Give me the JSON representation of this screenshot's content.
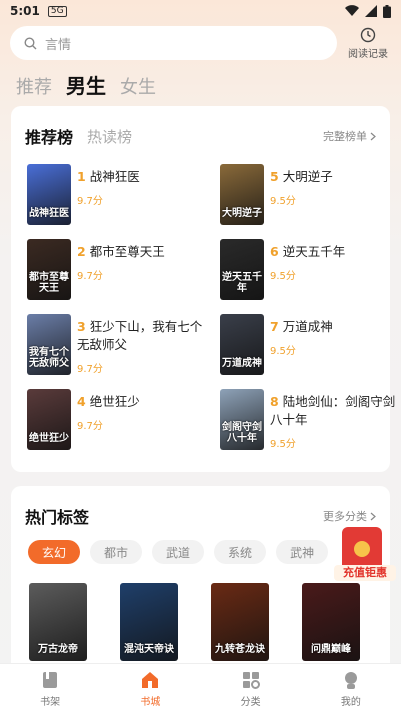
{
  "status": {
    "time": "5:01",
    "sim_label": "5G"
  },
  "search": {
    "placeholder": "言情"
  },
  "history": {
    "label": "阅读记录"
  },
  "top_tabs": [
    {
      "label": "推荐",
      "active": false
    },
    {
      "label": "男生",
      "active": true
    },
    {
      "label": "女生",
      "active": false
    }
  ],
  "ranking": {
    "title": "推荐榜",
    "sub_tab": "热读榜",
    "more": "完整榜单",
    "items": [
      {
        "num": "1",
        "name": "战神狂医",
        "score": "9.7分",
        "cover_text": "战神狂医",
        "cover_color": "#4a6fd8"
      },
      {
        "num": "2",
        "name": "都市至尊天王",
        "score": "9.7分",
        "cover_text": "都市至尊天王",
        "cover_color": "#3b2a22"
      },
      {
        "num": "3",
        "name": "狂少下山，我有七个无敌师父",
        "score": "9.7分",
        "cover_text": "我有七个无敌师父",
        "cover_color": "#6b7ea8"
      },
      {
        "num": "4",
        "name": "绝世狂少",
        "score": "9.7分",
        "cover_text": "绝世狂少",
        "cover_color": "#5a3b3b"
      },
      {
        "num": "5",
        "name": "大明逆子",
        "score": "9.5分",
        "cover_text": "大明逆子",
        "cover_color": "#8a6a3a"
      },
      {
        "num": "6",
        "name": "逆天五千年",
        "score": "9.5分",
        "cover_text": "逆天五千年",
        "cover_color": "#2a2a2a"
      },
      {
        "num": "7",
        "name": "万道成神",
        "score": "9.5分",
        "cover_text": "万道成神",
        "cover_color": "#3a3f4a"
      },
      {
        "num": "8",
        "name": "陆地剑仙：剑阁守剑八十年",
        "score": "9.5分",
        "cover_text": "剑阁守剑八十年",
        "cover_color": "#8ea2b8"
      }
    ]
  },
  "tags": {
    "title": "热门标签",
    "more": "更多分类",
    "chips": [
      {
        "label": "玄幻",
        "active": true
      },
      {
        "label": "都市",
        "active": false
      },
      {
        "label": "武道",
        "active": false
      },
      {
        "label": "系统",
        "active": false
      },
      {
        "label": "武神",
        "active": false
      }
    ],
    "books": [
      {
        "cover_text": "万古龙帝",
        "cover_color": "#5c5c5c"
      },
      {
        "cover_text": "混沌天帝诀",
        "cover_color": "#1f3f6a"
      },
      {
        "cover_text": "九转苍龙诀",
        "cover_color": "#6a2a14"
      },
      {
        "cover_text": "问鼎巅峰",
        "cover_color": "#4a1a1a"
      }
    ]
  },
  "promo": {
    "label": "充值钜惠"
  },
  "bottom_nav": [
    {
      "label": "书架",
      "icon": "book-icon",
      "active": false
    },
    {
      "label": "书城",
      "icon": "home-icon",
      "active": true
    },
    {
      "label": "分类",
      "icon": "grid-icon",
      "active": false
    },
    {
      "label": "我的",
      "icon": "user-icon",
      "active": false
    }
  ],
  "colors": {
    "accent": "#f26b2a",
    "score": "#f0a12c"
  }
}
